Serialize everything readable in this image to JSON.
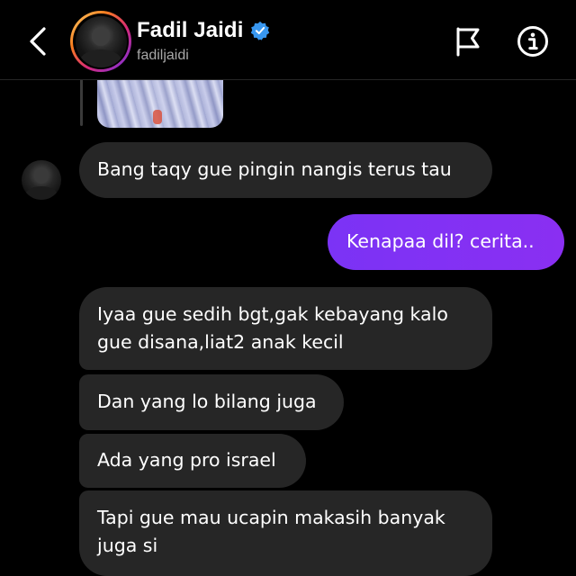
{
  "header": {
    "display_name": "Fadil Jaidi",
    "username": "fadiljaidi",
    "verified": true,
    "icons": {
      "back": "chevron-left-icon",
      "verified": "verified-badge-icon",
      "flag": "flag-icon",
      "info": "info-icon"
    }
  },
  "colors": {
    "background": "#000000",
    "incoming_bubble": "#262626",
    "outgoing_bubble": "#7b33f5",
    "verified_blue": "#3897f0",
    "username_gray": "#a8a8a8"
  },
  "messages": [
    {
      "direction": "incoming",
      "text": "Bang taqy gue pingin nangis terus tau"
    },
    {
      "direction": "outgoing",
      "text": "Kenapaa dil? cerita.."
    },
    {
      "direction": "incoming",
      "text": "Iyaa gue sedih bgt,gak kebayang kalo gue disana,liat2 anak kecil"
    },
    {
      "direction": "incoming",
      "text": "Dan yang lo bilang juga"
    },
    {
      "direction": "incoming",
      "text": "Ada yang pro israel"
    },
    {
      "direction": "incoming",
      "text": "Tapi gue mau ucapin makasih banyak juga si"
    }
  ]
}
